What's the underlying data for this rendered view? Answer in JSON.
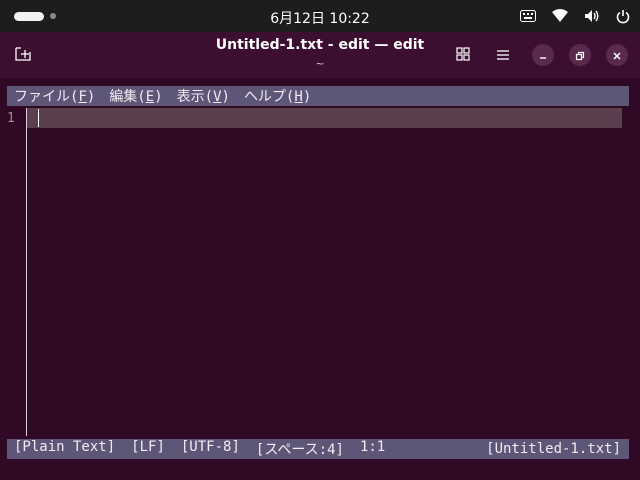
{
  "system_bar": {
    "clock": "6月12日  10:22",
    "icons": [
      "activities-indicator",
      "keyboard-icon",
      "wifi-icon",
      "volume-icon",
      "power-icon"
    ]
  },
  "window": {
    "title": "Untitled-1.txt - edit — edit",
    "subtitle": "~",
    "buttons": [
      "new-tab-icon",
      "grid-icon",
      "hamburger-menu-icon",
      "minimize-icon",
      "restore-icon",
      "close-icon"
    ]
  },
  "editor": {
    "menu": [
      {
        "pre": "ファイル(",
        "key": "F",
        "post": ")"
      },
      {
        "pre": "編集(",
        "key": "E",
        "post": ")"
      },
      {
        "pre": "表示(",
        "key": "V",
        "post": ")"
      },
      {
        "pre": "ヘルプ(",
        "key": "H",
        "post": ")"
      }
    ],
    "line_number": "1",
    "status": {
      "syntax": "[Plain Text]",
      "line_ending": "[LF]",
      "encoding": "[UTF-8]",
      "indent": "[スペース:4]",
      "position": "1:1",
      "filename": "[Untitled-1.txt]"
    }
  },
  "colors": {
    "terminal_bg": "#300a24",
    "header_bg": "#3c0f31",
    "bar_bg": "#5e5677",
    "current_line": "#5c3f4f"
  }
}
